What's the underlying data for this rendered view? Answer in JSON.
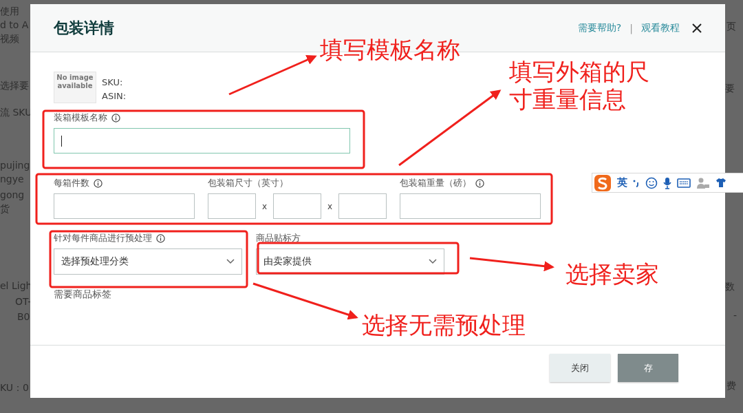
{
  "background_page": {
    "fragments": [
      "使用",
      "d to A",
      "视频",
      "选择要",
      "流 SKU",
      "pujing",
      "ngye",
      "gong",
      "货",
      "el Ligh",
      "OT-",
      "B0",
      "KU：0",
      "页",
      "要",
      "数",
      "-",
      "费"
    ]
  },
  "dialog": {
    "title": "包装详情",
    "help_link": "需要帮助?",
    "separator": "|",
    "tutorial_link": "观看教程",
    "product": {
      "image_text": "No image available",
      "sku_label": "SKU:",
      "asin_label": "ASIN:"
    },
    "template_name": {
      "label": "装箱模板名称",
      "info": true,
      "focused": true
    },
    "box_row": [
      {
        "kind": "single",
        "label": "每箱件数",
        "info": true
      },
      {
        "kind": "dimensions",
        "label": "包装箱尺寸（英寸）",
        "info": false,
        "separators": [
          "x",
          "x"
        ]
      },
      {
        "kind": "single",
        "label": "包装箱重量（磅）",
        "info": true
      }
    ],
    "prep": {
      "label": "针对每件商品进行预处理",
      "info": true,
      "placeholder": "选择预处理分类"
    },
    "labeling": {
      "label": "商品贴标方",
      "info": false,
      "value": "由卖家提供"
    },
    "label_required": "需要商品标签",
    "buttons": [
      {
        "kind": "secondary",
        "label": "关闭"
      },
      {
        "kind": "primary",
        "label": "存"
      }
    ]
  },
  "ime_toolbar": {
    "mode": "英"
  },
  "annotations": [
    "填写模板名称",
    "填写外箱的尺寸重量信息",
    "选择卖家",
    "选择无需预处理"
  ]
}
